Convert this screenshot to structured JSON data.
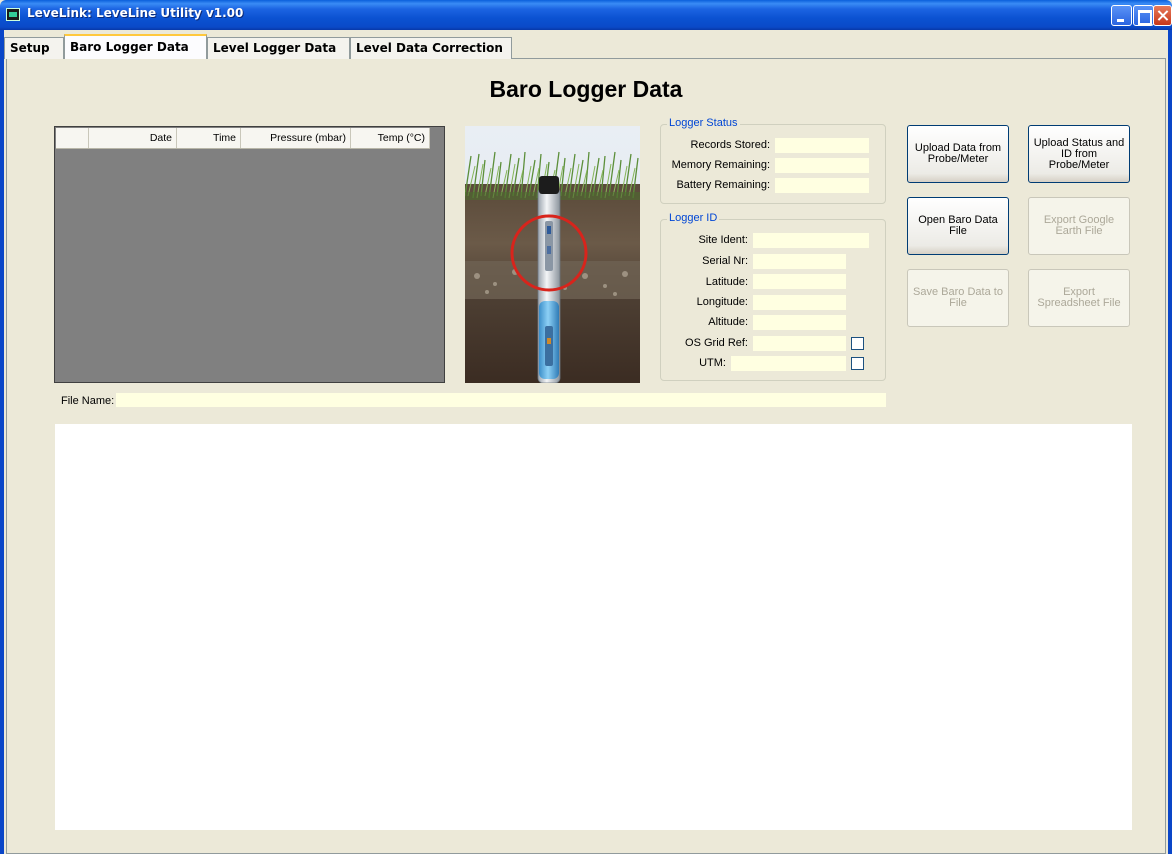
{
  "window": {
    "title": "LeveLink: LeveLine Utility v1.00"
  },
  "tabs": [
    {
      "label": "Setup"
    },
    {
      "label": "Baro Logger Data"
    },
    {
      "label": "Level Logger Data"
    },
    {
      "label": "Level Data Correction"
    }
  ],
  "active_tab": "Baro Logger Data",
  "page": {
    "title": "Baro Logger Data"
  },
  "grid": {
    "columns": [
      "",
      "Date",
      "Time",
      "Pressure (mbar)",
      "Temp (°C)"
    ],
    "rows": []
  },
  "logger_status": {
    "legend": "Logger Status",
    "records_stored_label": "Records Stored:",
    "records_stored": "",
    "memory_remaining_label": "Memory Remaining:",
    "memory_remaining": "",
    "battery_remaining_label": "Battery Remaining:",
    "battery_remaining": ""
  },
  "logger_id": {
    "legend": "Logger ID",
    "site_ident_label": "Site Ident:",
    "site_ident": "",
    "serial_label": "Serial Nr:",
    "serial": "",
    "latitude_label": "Latitude:",
    "latitude": "",
    "longitude_label": "Longitude:",
    "longitude": "",
    "altitude_label": "Altitude:",
    "altitude": "",
    "os_grid_label": "OS Grid Ref:",
    "os_grid": "",
    "os_grid_checked": false,
    "utm_label": "UTM:",
    "utm": "",
    "utm_checked": false
  },
  "buttons": {
    "upload_data": "Upload Data from Probe/Meter",
    "upload_status": "Upload Status and ID from Probe/Meter",
    "open_baro": "Open Baro Data File",
    "export_google": "Export Google Earth File",
    "save_baro": "Save Baro Data to File",
    "export_spreadsheet": "Export Spreadsheet File"
  },
  "file": {
    "label": "File Name:",
    "value": ""
  },
  "colors": {
    "titlebar": "#0A5FDC",
    "field_bg": "#FFFFE1",
    "legend_text": "#0046D5",
    "panel_bg": "#ECE9D8",
    "grid_bg": "#808080"
  }
}
